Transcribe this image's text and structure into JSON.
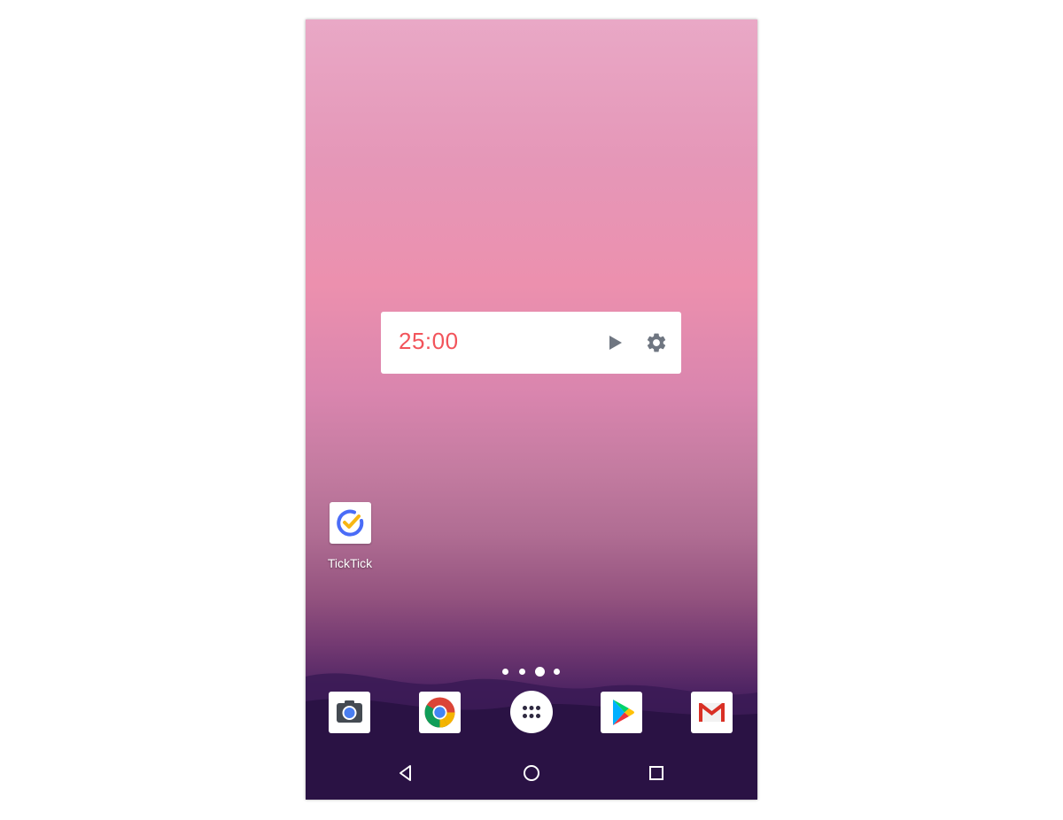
{
  "widget": {
    "timer": "25:00",
    "timer_color": "#f2545b",
    "play_icon": "play-icon",
    "settings_icon": "gear-icon"
  },
  "home_apps": [
    {
      "label": "TickTick",
      "icon": "ticktick-icon"
    }
  ],
  "page_indicator": {
    "pages": 4,
    "current": 3
  },
  "dock": [
    {
      "icon": "camera-icon"
    },
    {
      "icon": "chrome-icon"
    },
    {
      "icon": "app-drawer-icon"
    },
    {
      "icon": "play-store-icon"
    },
    {
      "icon": "gmail-icon"
    }
  ],
  "nav_bar": [
    "back-icon",
    "home-icon",
    "recents-icon"
  ]
}
